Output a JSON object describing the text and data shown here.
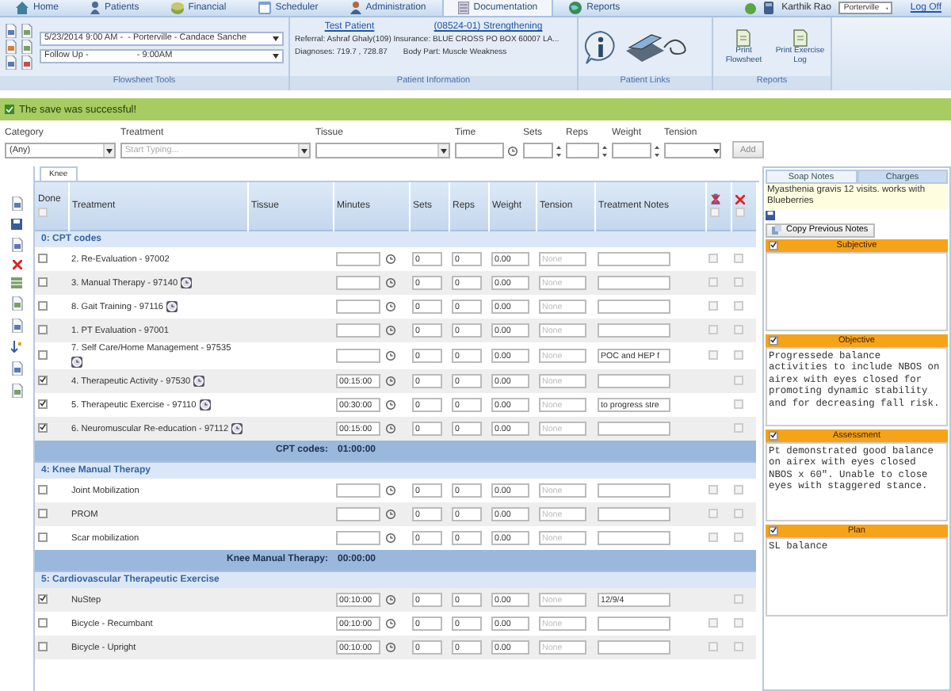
{
  "nav": {
    "tabs": [
      {
        "label": "Home",
        "selected": false
      },
      {
        "label": "Patients",
        "selected": false
      },
      {
        "label": "Financial",
        "selected": false
      },
      {
        "label": "Scheduler",
        "selected": false
      },
      {
        "label": "Administration",
        "selected": false
      },
      {
        "label": "Documentation",
        "selected": true
      },
      {
        "label": "Reports",
        "selected": false
      }
    ],
    "user": "Karthik Rao",
    "location": "Porterville",
    "logoff": "Log Off"
  },
  "ribbon": {
    "flowsheet": {
      "visit": "5/23/2014 9:00 AM -  - Porterville - Candace Sanche",
      "visit_type": "Follow Up -                    - 9:00AM",
      "label": "Flowsheet Tools"
    },
    "patient": {
      "name": "Test Patient",
      "case": "(08524-01) Strengthening",
      "referral": "Referral:  Ashraf Ghaly(109) Insurance: BLUE CROSS PO BOX 60007 LA...",
      "diagnoses": "Diagnoses: 719.7 , 728.87",
      "body_part": "Body Part: Muscle Weakness",
      "label": "Patient Information"
    },
    "links": {
      "label": "Patient Links"
    },
    "reports": {
      "buttons": [
        "Print Flowsheet",
        "Print Exercise Log"
      ],
      "label": "Reports"
    }
  },
  "message": "The save was successful!",
  "add_form": {
    "category": {
      "label": "Category",
      "value": "(Any)"
    },
    "treatment": {
      "label": "Treatment",
      "placeholder": "Start Typing..."
    },
    "tissue": {
      "label": "Tissue"
    },
    "time": {
      "label": "Time"
    },
    "sets": {
      "label": "Sets"
    },
    "reps": {
      "label": "Reps"
    },
    "weight": {
      "label": "Weight"
    },
    "tension": {
      "label": "Tension"
    },
    "button": "Add"
  },
  "table": {
    "tab": "Knee",
    "columns": [
      "Done",
      "Treatment",
      "Tissue",
      "Minutes",
      "Sets",
      "Reps",
      "Weight",
      "Tension",
      "Treatment Notes"
    ],
    "header_checks": [
      {
        "checked": false
      },
      {
        "checked": false
      },
      {
        "checked": false
      }
    ],
    "sections": [
      {
        "title": "0: CPT codes",
        "total_label": "CPT codes:",
        "total_value": "01:00:00",
        "rows": [
          {
            "name": "2. Re-Evaluation - 97002",
            "done": false,
            "timer": false,
            "sets": "0",
            "reps": "0",
            "weight": "0.00",
            "placeholder": "None",
            "flag_box": true,
            "remove": false
          },
          {
            "name": "3. Manual Therapy - 97140",
            "done": false,
            "timer": true,
            "sets": "0",
            "reps": "0",
            "weight": "0.00",
            "placeholder": "None",
            "flag_box": true,
            "remove": false
          },
          {
            "name": "8. Gait Training - 97116",
            "done": false,
            "timer": true,
            "sets": "0",
            "reps": "0",
            "weight": "0.00",
            "placeholder": "None",
            "flag_box": true,
            "remove": false
          },
          {
            "name": "1. PT Evaluation - 97001",
            "done": false,
            "timer": false,
            "sets": "0",
            "reps": "0",
            "weight": "0.00",
            "placeholder": "None",
            "flag_box": true,
            "remove": false
          },
          {
            "name": "7. Self Care/Home Management - 97535",
            "done": false,
            "timer": true,
            "sets": "0",
            "reps": "0",
            "weight": "0.00",
            "placeholder": "None",
            "notes": "POC and HEP f",
            "flag_box": true,
            "remove": false
          },
          {
            "name": "4. Therapeutic Activity - 97530",
            "done": true,
            "timer": true,
            "minutes": "00:15:00",
            "sets": "0",
            "reps": "0",
            "weight": "0.00",
            "placeholder": "None",
            "flag_box": false,
            "remove": false
          },
          {
            "name": "5. Therapeutic Exercise - 97110",
            "done": true,
            "timer": true,
            "minutes": "00:30:00",
            "sets": "0",
            "reps": "0",
            "weight": "0.00",
            "placeholder": "None",
            "notes": "to progress stre",
            "flag_box": false,
            "remove": false
          },
          {
            "name": "6. Neuromuscular Re-education - 97112",
            "done": true,
            "timer": true,
            "minutes": "00:15:00",
            "sets": "0",
            "reps": "0",
            "weight": "0.00",
            "placeholder": "None",
            "flag_box": false,
            "remove": false
          }
        ]
      },
      {
        "title": "4: Knee Manual Therapy",
        "total_label": "Knee Manual Therapy:",
        "total_value": "00:00:00",
        "rows": [
          {
            "name": "Joint Mobilization",
            "done": false,
            "timer": false,
            "sets": "0",
            "reps": "0",
            "weight": "0.00",
            "placeholder": "None",
            "flag_box": true,
            "remove": false
          },
          {
            "name": "PROM",
            "done": false,
            "timer": false,
            "sets": "0",
            "reps": "0",
            "weight": "0.00",
            "placeholder": "None",
            "flag_box": true,
            "remove": false
          },
          {
            "name": "Scar mobilization",
            "done": false,
            "timer": false,
            "sets": "0",
            "reps": "0",
            "weight": "0.00",
            "placeholder": "None",
            "flag_box": true,
            "remove": false
          }
        ]
      },
      {
        "title": "5: Cardiovascular Therapeutic Exercise",
        "rows": [
          {
            "name": "NuStep",
            "done": true,
            "timer": false,
            "minutes": "00:10:00",
            "sets": "0",
            "reps": "0",
            "weight": "0.00",
            "placeholder": "None",
            "notes": "12/9/4",
            "flag_box": false,
            "remove": false
          },
          {
            "name": "Bicycle - Recumbant",
            "done": false,
            "timer": false,
            "minutes": "00:10:00",
            "sets": "0",
            "reps": "0",
            "weight": "0.00",
            "placeholder": "None",
            "flag_box": true,
            "remove": false
          },
          {
            "name": "Bicycle - Upright",
            "done": false,
            "timer": false,
            "minutes": "00:10:00",
            "sets": "0",
            "reps": "0",
            "weight": "0.00",
            "placeholder": "None",
            "flag_box": true,
            "remove": false
          }
        ]
      }
    ]
  },
  "soap": {
    "tabs": [
      {
        "label": "Soap Notes",
        "selected": true
      },
      {
        "label": "Charges",
        "selected": false
      }
    ],
    "note": "Myasthenia gravis 12 visits. works with Blueberries",
    "copy_button": "Copy Previous Notes",
    "sections": [
      {
        "title": "Subjective",
        "checked": true
      },
      {
        "title": "Objective",
        "checked": true,
        "text": "Progressede balance activities to include NBOS on airex with eyes closed for promoting dynamic stability and for decreasing fall risk."
      },
      {
        "title": "Assessment",
        "checked": true,
        "text": "Pt demonstrated good balance on airex with eyes closed NBOS x 60\". Unable to close eyes with staggered stance."
      },
      {
        "title": "Plan",
        "checked": true,
        "text": "SL balance"
      }
    ]
  }
}
